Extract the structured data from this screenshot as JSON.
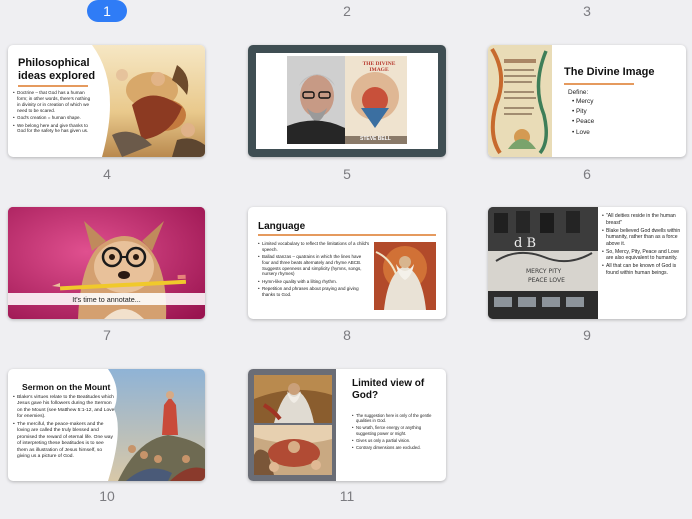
{
  "slides": [
    {
      "number": "1"
    },
    {
      "number": "2"
    },
    {
      "number": "3"
    },
    {
      "number": "4",
      "title": "Philosophical ideas explored",
      "bullets": [
        "Doctrine – that God has a human form; in other words, there's nothing in divinity or in creation of which we need to be scared.",
        "God's creation = human shape.",
        "We belong here and give thanks to God for the safety he has given us."
      ]
    },
    {
      "number": "5",
      "book_title": "THE DIVINE IMAGE",
      "book_author": "STEVE BELL"
    },
    {
      "number": "6",
      "title": "The Divine Image",
      "define_label": "Define:",
      "items": [
        "Mercy",
        "Pity",
        "Peace",
        "Love"
      ]
    },
    {
      "number": "7",
      "caption": "It's time to annotate..."
    },
    {
      "number": "8",
      "title": "Language",
      "bullets": [
        "Limited vocabulary to reflect the limitations of a child's speech.",
        "Ballad stanzas – quatrains in which the lines have four and three beats alternately and rhyme ABCB. Suggests openness and simplicity (hymns, songs, nursery rhymes)",
        "Hymn-like quality with a lilting rhythm.",
        "Repetition and phrases about praying and giving thanks to God."
      ]
    },
    {
      "number": "9",
      "bullets": [
        "\"All deities reside in the human breast\"",
        "Blake believed God dwells within humanity, rather than as a force above it.",
        "So, Mercy, Pity, Peace and Love are also equivalent to humanity.",
        "All that can be known of God is found within human beings."
      ]
    },
    {
      "number": "10",
      "title": "Sermon on the Mount",
      "bullets": [
        "Blake's virtues relate to the Beatitudes which Jesus gave his followers during the Sermon on the Mount (see Matthew 5:1-12, and Love for enemies).",
        "The merciful, the peace-makers and the loving are called the truly blessed and promised the reward of eternal life. One way of interpreting these beatitudes is to see them as illustration of Jesus himself, so giving us a picture of God."
      ]
    },
    {
      "number": "11",
      "title": "Limited view of God?",
      "bullets": [
        "The suggestion here is only of the gentle qualities in God.",
        "No wrath, fierce energy or anything suggesting power or might.",
        "Gives us only a partial vision.",
        "Contrary dimensions are excluded."
      ]
    }
  ]
}
